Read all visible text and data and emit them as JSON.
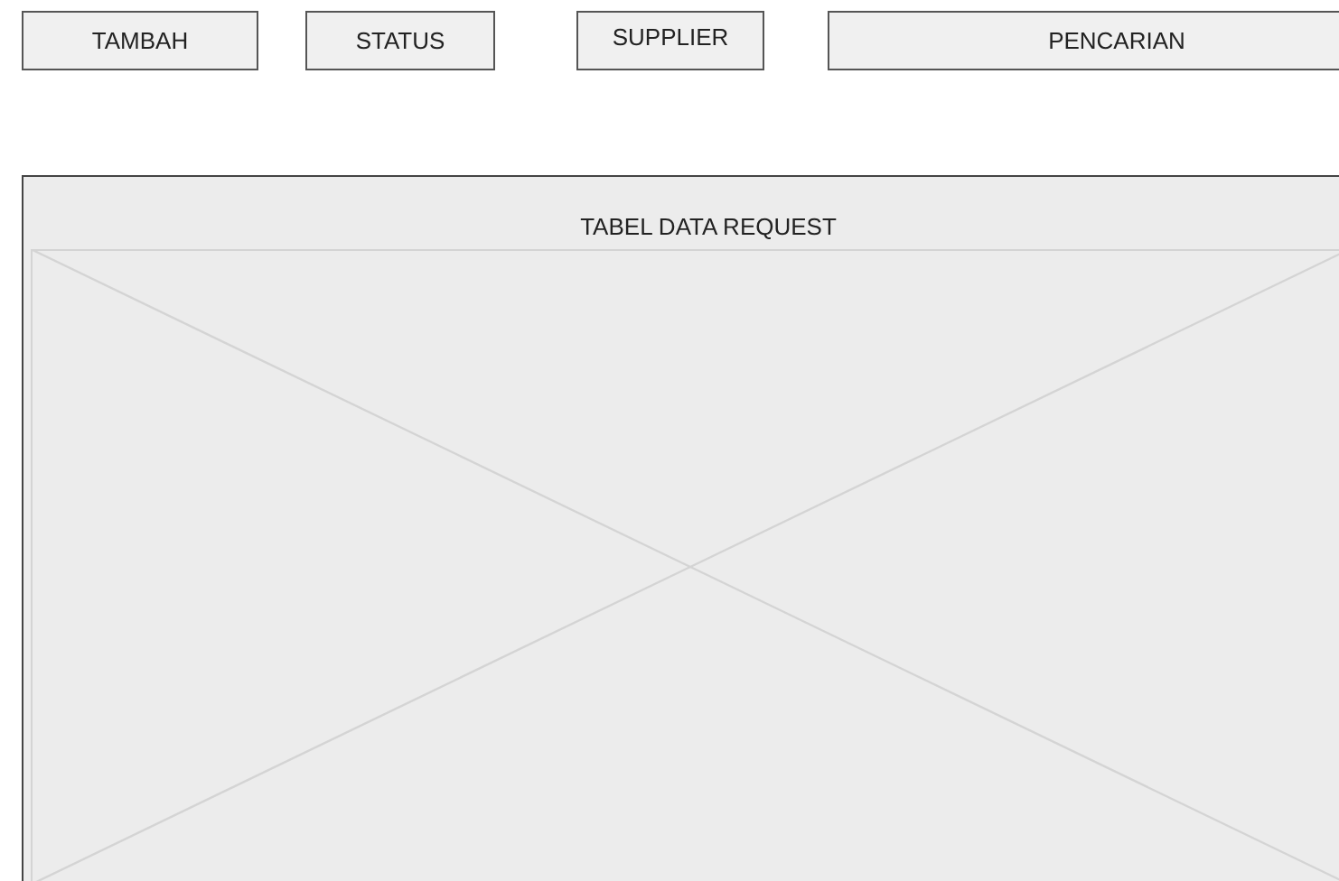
{
  "toolbar": {
    "buttons": [
      {
        "label": "TAMBAH",
        "kind": "plain"
      },
      {
        "label": "STATUS",
        "kind": "plain"
      },
      {
        "label": "SUPPLIER",
        "kind": "raised"
      },
      {
        "label": "PENCARIAN",
        "kind": "wide"
      }
    ]
  },
  "table_panel": {
    "title": "TABEL DATA REQUEST"
  }
}
